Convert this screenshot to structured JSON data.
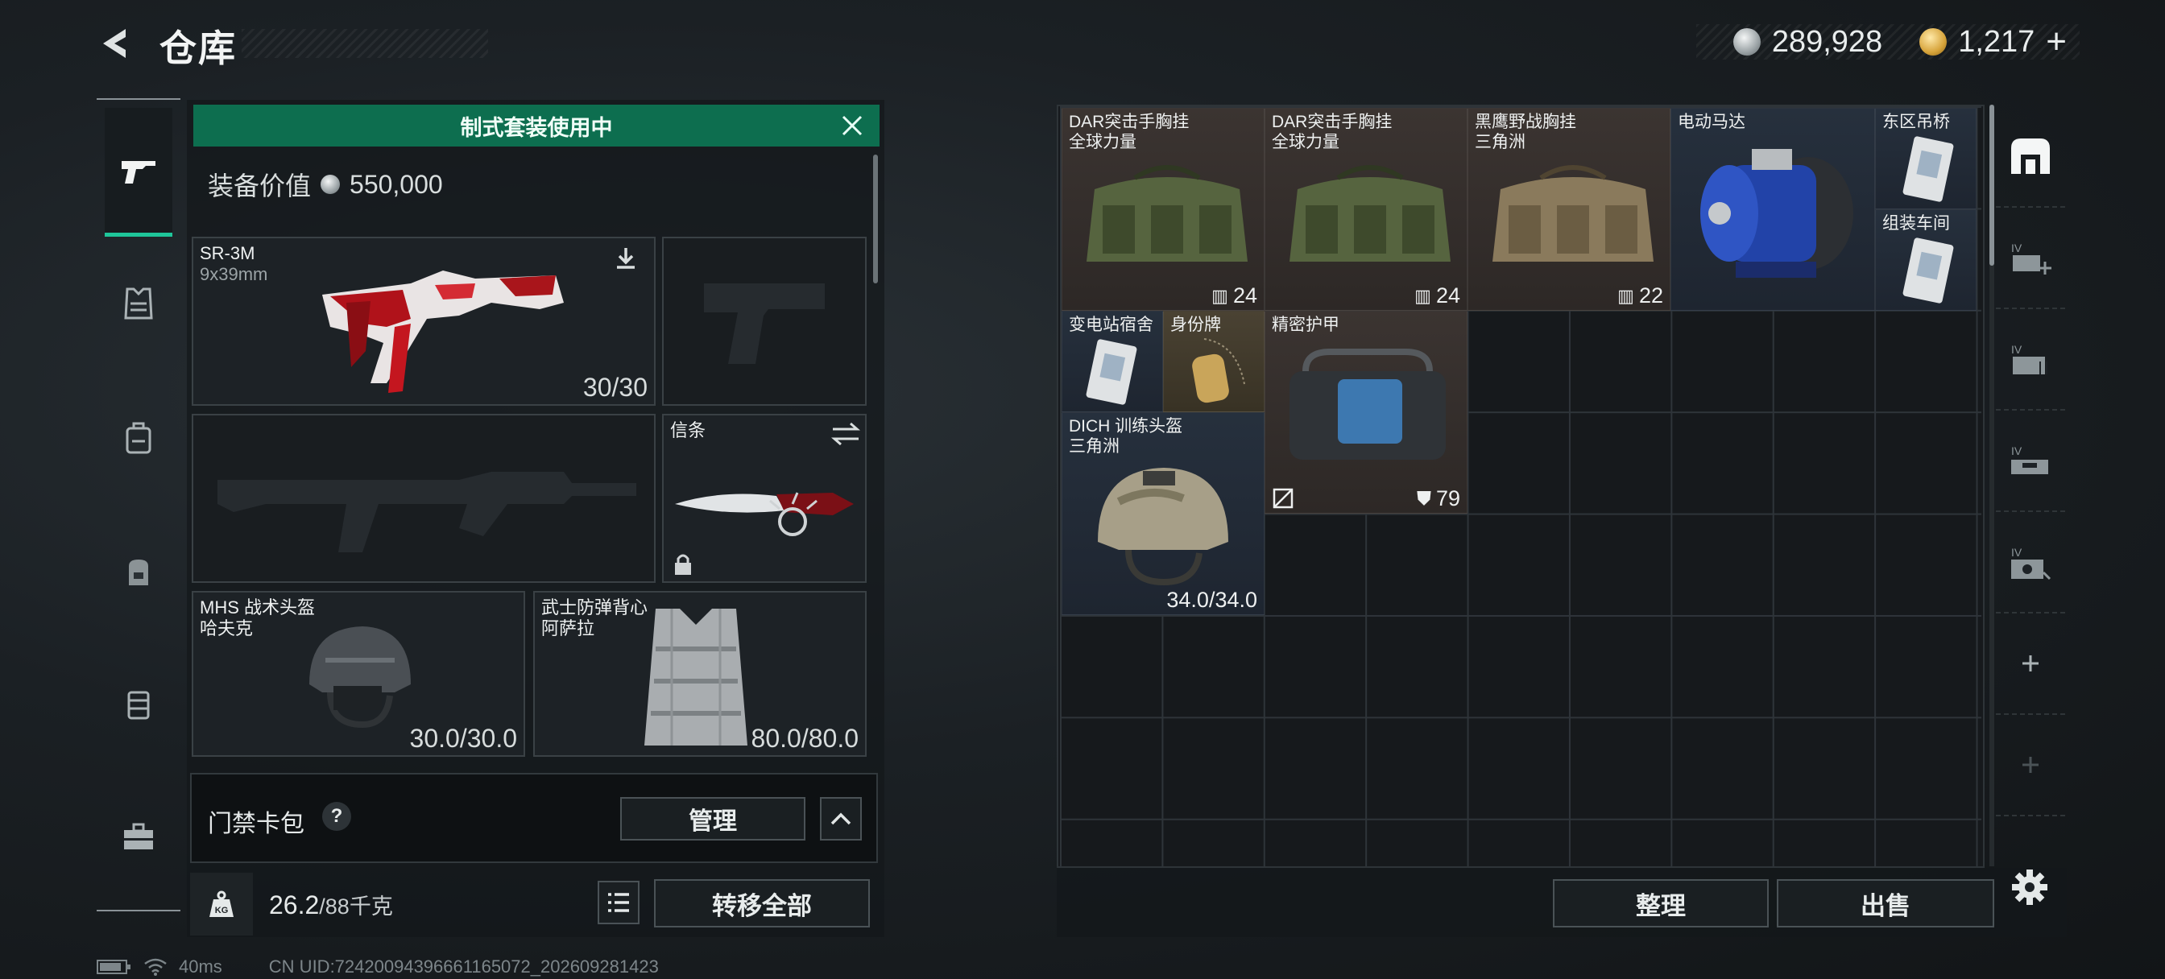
{
  "header": {
    "title": "仓库",
    "currency_silver": "289,928",
    "currency_gold": "1,217",
    "gold_plus": "+"
  },
  "left_nav": {
    "items": [
      "weapon-icon",
      "armor-icon",
      "chest-rig-icon",
      "backpack-icon",
      "pouch-icon",
      "toolbox-icon"
    ],
    "active": 0
  },
  "loadout": {
    "banner": "制式套装使用中",
    "value_label": "装备价值",
    "value": "550,000",
    "primary": {
      "name": "SR-3M",
      "caliber": "9x39mm",
      "ammo": "30/30"
    },
    "melee": {
      "name": "信条"
    },
    "helmet": {
      "name": "MHS 战术头盔",
      "sub": "哈夫克",
      "durability": "30.0/30.0"
    },
    "armor": {
      "name": "武士防弹背心",
      "sub": "阿萨拉",
      "durability": "80.0/80.0"
    }
  },
  "card_pack": {
    "label": "门禁卡包",
    "help": "?",
    "manage": "管理"
  },
  "weight": {
    "current": "26.2",
    "max": "/88千克"
  },
  "transfer_all": "转移全部",
  "stash": {
    "items": [
      {
        "id": "dar1",
        "name": "DAR突击手胸挂",
        "sub": "全球力量",
        "value": "24"
      },
      {
        "id": "dar2",
        "name": "DAR突击手胸挂",
        "sub": "全球力量",
        "value": "24"
      },
      {
        "id": "eagle",
        "name": "黑鹰野战胸挂",
        "sub": "三角洲",
        "value": "22"
      },
      {
        "id": "motor",
        "name": "电动马达"
      },
      {
        "id": "card1",
        "name": "东区吊桥"
      },
      {
        "id": "card2",
        "name": "组装车间"
      },
      {
        "id": "card3",
        "name": "变电站宿舍"
      },
      {
        "id": "tag",
        "name": "身份牌"
      },
      {
        "id": "precise",
        "name": "精密护甲",
        "value": "79"
      },
      {
        "id": "dich",
        "name": "DICH 训练头盔",
        "sub": "三角洲",
        "value": "34.0/34.0"
      }
    ],
    "sort": "整理",
    "sell": "出售"
  },
  "right_nav": {
    "items": [
      "warehouse-icon",
      "stash-expand-icon",
      "stash-box-icon",
      "stash-case-icon",
      "stash-safe-icon",
      "add-icon",
      "add-icon-disabled"
    ]
  },
  "status": {
    "ping": "40ms",
    "uid": "CN UID:7242009439666116507​2_202609281423"
  },
  "colors": {
    "accent": "#1fc69a",
    "banner": "#0d6e4f"
  }
}
